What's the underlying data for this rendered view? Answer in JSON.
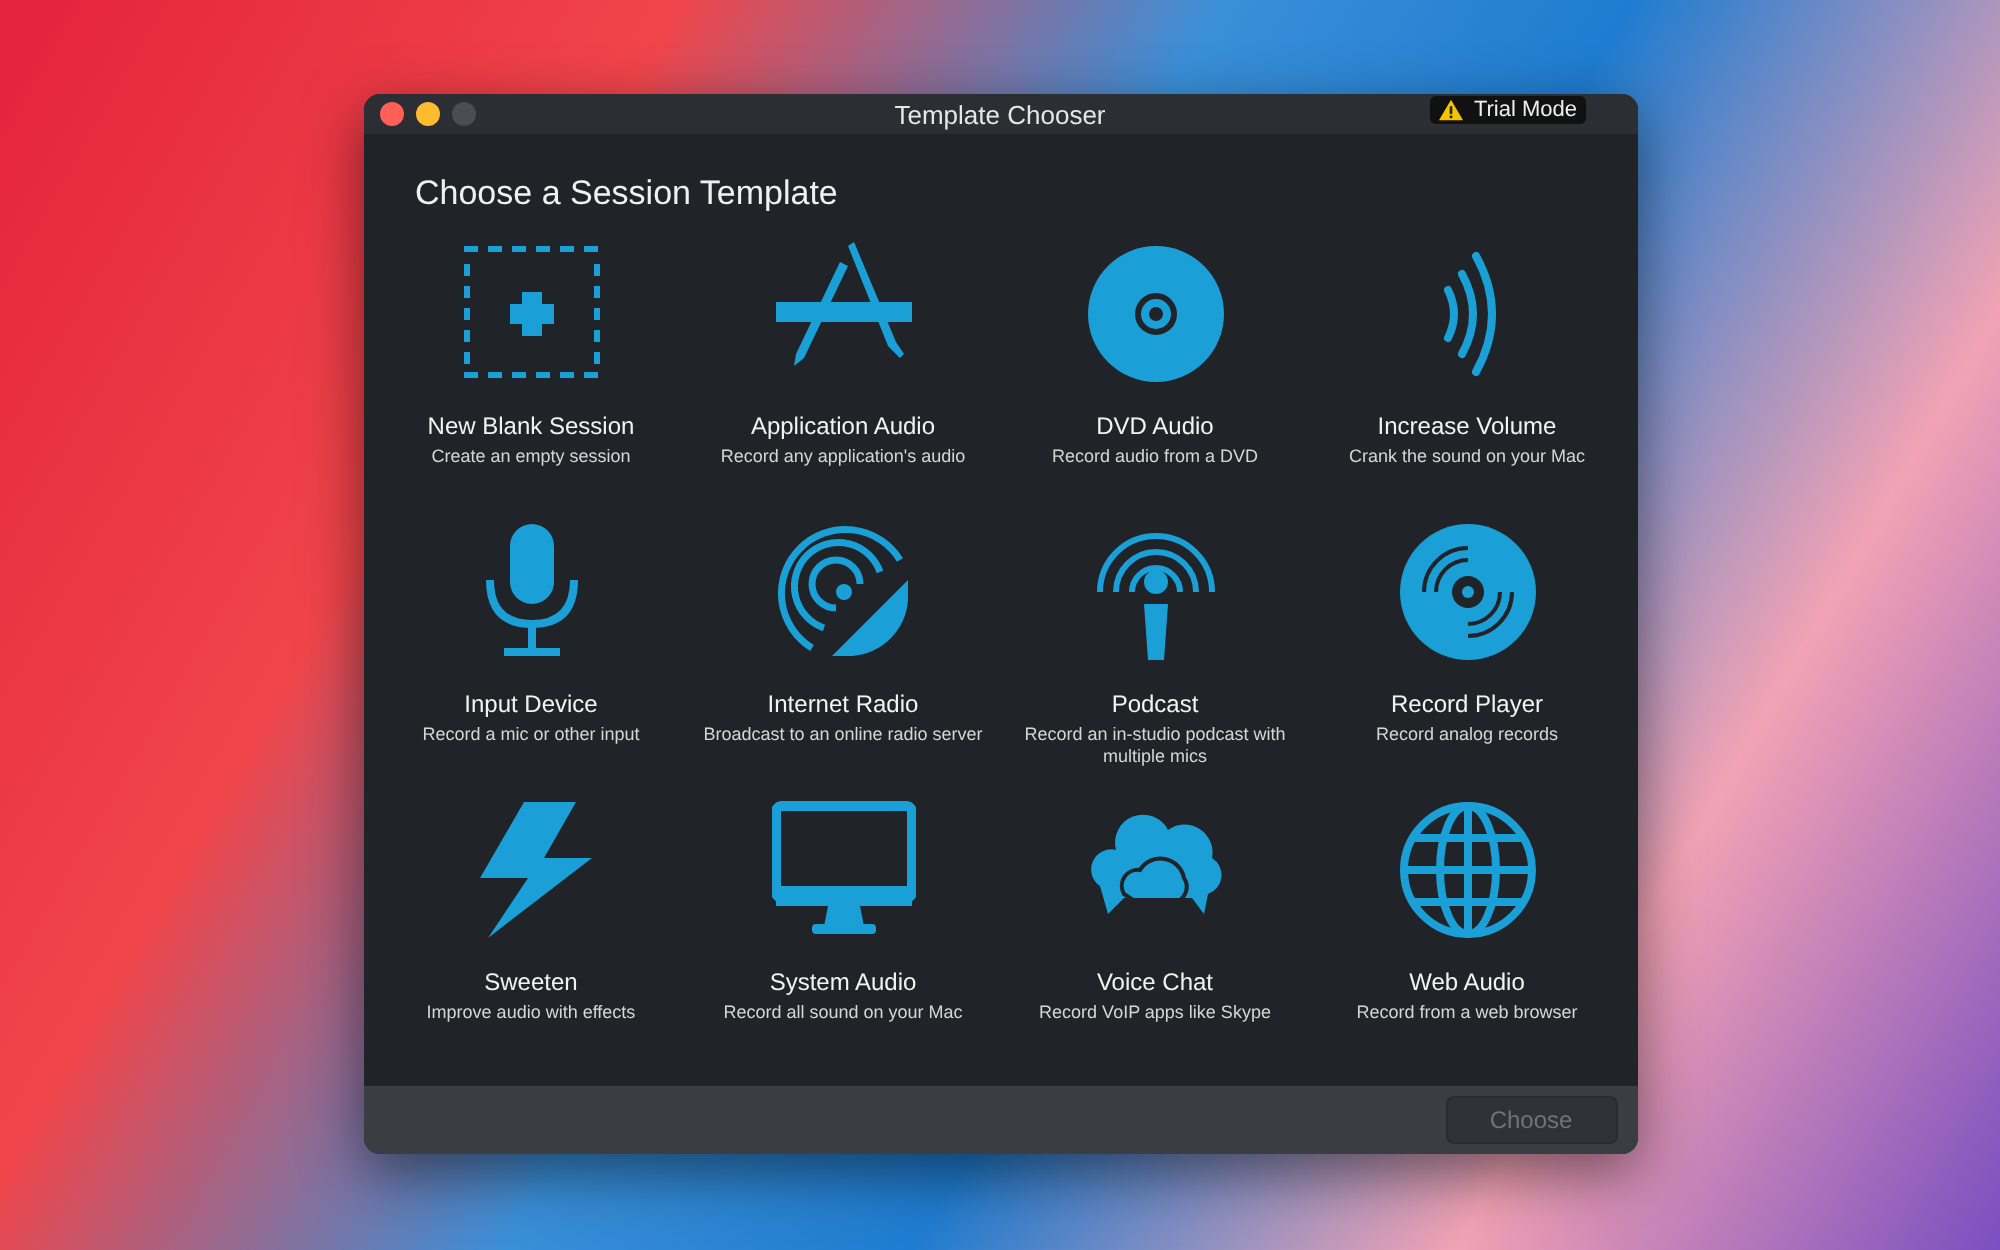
{
  "window": {
    "title": "Template Chooser",
    "badge": "Trial Mode"
  },
  "heading": "Choose a Session Template",
  "templates": [
    {
      "kind": "blank",
      "name": "New Blank Session",
      "description": "Create an empty session"
    },
    {
      "kind": "app",
      "name": "Application Audio",
      "description": "Record any application's audio"
    },
    {
      "kind": "dvd",
      "name": "DVD Audio",
      "description": "Record audio from a DVD"
    },
    {
      "kind": "volume",
      "name": "Increase Volume",
      "description": "Crank the sound on your Mac"
    },
    {
      "kind": "mic",
      "name": "Input Device",
      "description": "Record a mic or other input"
    },
    {
      "kind": "radio",
      "name": "Internet Radio",
      "description": "Broadcast to an online radio server"
    },
    {
      "kind": "podcast",
      "name": "Podcast",
      "description": "Record an in-studio podcast with multiple mics"
    },
    {
      "kind": "record",
      "name": "Record Player",
      "description": "Record analog records"
    },
    {
      "kind": "bolt",
      "name": "Sweeten",
      "description": "Improve audio with effects"
    },
    {
      "kind": "monitor",
      "name": "System Audio",
      "description": "Record all sound on your Mac"
    },
    {
      "kind": "clouds",
      "name": "Voice Chat",
      "description": "Record VoIP apps like Skype"
    },
    {
      "kind": "globe",
      "name": "Web Audio",
      "description": "Record from a web browser"
    }
  ],
  "choose_button": {
    "label": "Choose",
    "disabled": true
  }
}
